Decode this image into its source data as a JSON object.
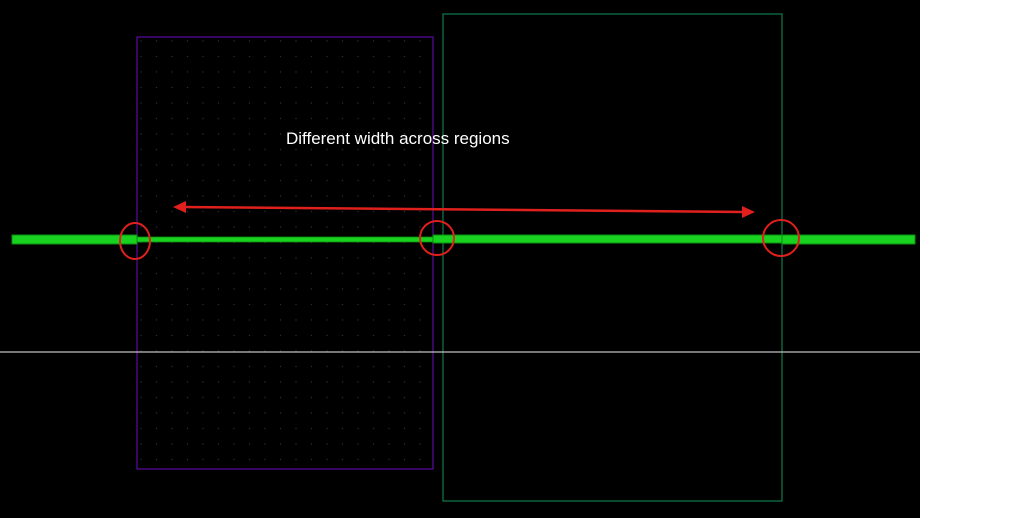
{
  "annotation": {
    "text": "Different width across regions"
  },
  "colors": {
    "background": "#000000",
    "page_margin": "#ffffff",
    "region_left_outline": "#5b0aa0",
    "region_right_outline": "#0f7a4e",
    "wire": "#19d11f",
    "wire_dark": "#0a8f10",
    "marker": "#e0201c",
    "guide_line": "#bfbfbf",
    "grid_dots": "#2a2a40"
  },
  "elements": {
    "regions": [
      "purple-outline-region",
      "green-outline-region"
    ],
    "markers": [
      "circle-marker-left",
      "circle-marker-middle",
      "circle-marker-right"
    ],
    "arrow": "double-headed-arrow"
  }
}
